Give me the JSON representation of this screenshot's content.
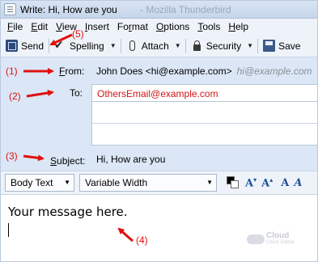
{
  "window": {
    "title": "Write: Hi, How are you",
    "title_faded": "- Mozilla Thunderbird"
  },
  "menu": [
    "File",
    "Edit",
    "View",
    "Insert",
    "Format",
    "Options",
    "Tools",
    "Help"
  ],
  "menu_access_keys": [
    "F",
    "E",
    "V",
    "I",
    "r",
    "O",
    "T",
    "H"
  ],
  "toolbar": {
    "send": "Send",
    "spelling": "Spelling",
    "attach": "Attach",
    "security": "Security",
    "save": "Save"
  },
  "header": {
    "from_label": "From:",
    "from_value": "John Does <hi@example.com>",
    "from_hint": "hi@example.com",
    "to_label": "To:",
    "to_value": "OthersEmail@example.com",
    "subject_label": "Subject:",
    "subject_value": "Hi, How are you"
  },
  "format": {
    "paragraph_style": "Body Text",
    "font": "Variable Width",
    "text_color": "#000000",
    "background_color": "#ffffff"
  },
  "body": {
    "text": "Your message here."
  },
  "annotations": {
    "a1": "(1)",
    "a2": "(2)",
    "a3": "(3)",
    "a4": "(4)",
    "a5": "(5)"
  },
  "watermark": {
    "brand": "Cloud",
    "sub": "Cloud Dahlia"
  },
  "colors": {
    "annotation": "#e01010",
    "to_text": "#d41414",
    "header_bg": "#dbe7f6",
    "toolbar_bg": "#eef3fa",
    "format_button": "#1f4f9a"
  }
}
